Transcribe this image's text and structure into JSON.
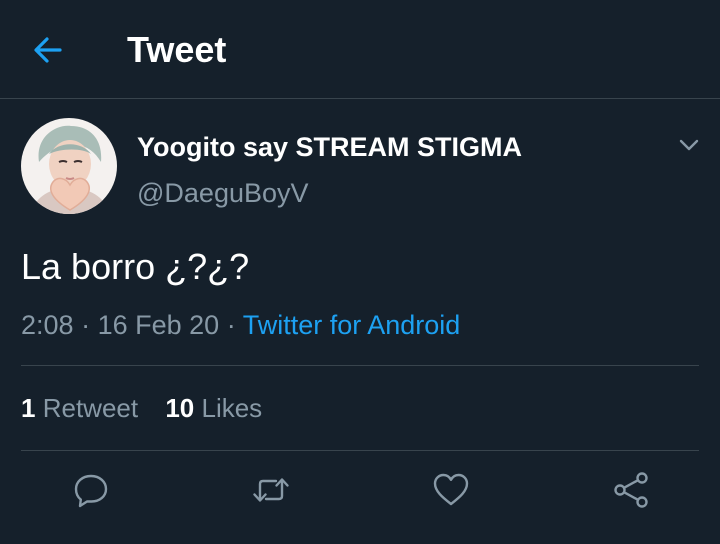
{
  "header": {
    "title": "Tweet",
    "back_icon": "arrow-left-icon"
  },
  "tweet": {
    "author": {
      "display_name": "Yoogito say STREAM STIGMA",
      "handle": "@DaeguBoyV",
      "avatar_icon": "avatar"
    },
    "text": "La borro ¿?¿?",
    "time": "2:08",
    "date": "16 Feb 20",
    "separator": "·",
    "source": "Twitter for Android",
    "retweets": {
      "count": "1",
      "label": "Retweet"
    },
    "likes": {
      "count": "10",
      "label": "Likes"
    }
  },
  "actions": [
    {
      "name": "reply",
      "icon": "reply-icon"
    },
    {
      "name": "retweet",
      "icon": "retweet-icon"
    },
    {
      "name": "like",
      "icon": "heart-icon"
    },
    {
      "name": "share",
      "icon": "share-icon"
    }
  ],
  "colors": {
    "background": "#15202b",
    "accent": "#1da1f2",
    "secondary_text": "#8899a6",
    "divider": "#38444d"
  }
}
